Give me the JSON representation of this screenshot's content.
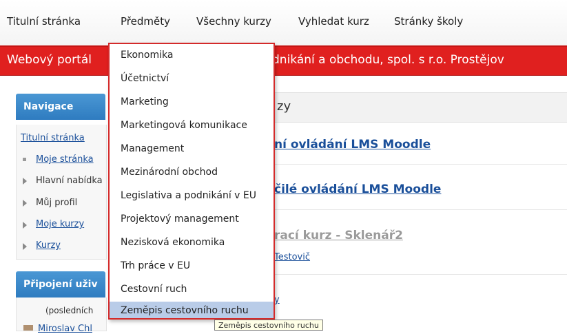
{
  "topnav": {
    "items": [
      "Titulní stránka",
      "Předměty",
      "Všechny kurzy",
      "Vyhledat kurz",
      "Stránky školy"
    ]
  },
  "banner": {
    "title_left": "Webový portál",
    "title_right": "dnikání a obchodu, spol. s r.o. Prostějov"
  },
  "navigation": {
    "title": "Navigace",
    "home": "Titulní stránka",
    "items": [
      {
        "label": "Moje stránka",
        "link": true
      },
      {
        "label": "Hlavní nabídka",
        "link": false
      },
      {
        "label": "Můj profil",
        "link": false
      },
      {
        "label": "Moje kurzy",
        "link": true
      },
      {
        "label": "Kurzy",
        "link": true
      }
    ]
  },
  "users_block": {
    "title": "Připojení uživ",
    "subtitle": "(posledních",
    "first_user": "Miroslav Chl"
  },
  "main": {
    "heading": "zy",
    "courses": [
      {
        "title": "ní ovládání LMS Moodle"
      },
      {
        "title": "čilé ovládání LMS Moodle"
      },
      {
        "title": "rací kurz - Sklenář2",
        "teacher": "Testovič"
      },
      {
        "teacher": "y"
      }
    ]
  },
  "dropdown": {
    "items": [
      "Ekonomika",
      "Účetnictví",
      "Marketing",
      "Marketingová komunikace",
      "Management",
      "Mezinárodní obchod",
      "Legislativa a podnikání v EU",
      "Projektový management",
      "Nezisková ekonomika",
      "Trh práce v EU",
      "Cestovní ruch",
      "Zeměpis cestovního ruchu"
    ],
    "hovered_index": 11
  },
  "tooltip": "Zeměpis cestovního ruchu",
  "colors": {
    "banner": "#e0201f",
    "block_header": "#2f7cc0",
    "link": "#1a4f9a",
    "menu_border": "#d42a2a",
    "menu_hover": "#b9cce8"
  }
}
